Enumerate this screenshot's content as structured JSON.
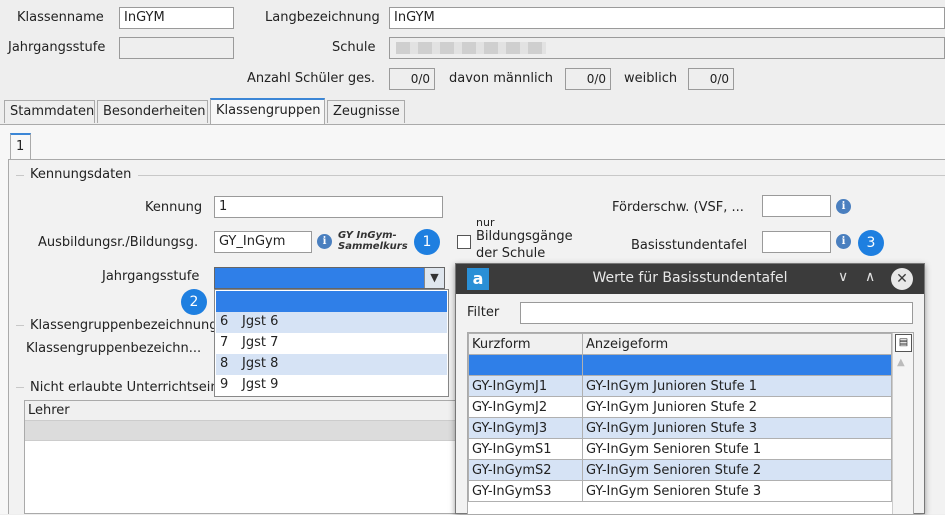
{
  "header": {
    "klassenname_label": "Klassenname",
    "klassenname_value": "InGYM",
    "langbezeichnung_label": "Langbezeichnung",
    "langbezeichnung_value": "InGYM",
    "jahrgangsstufe_label": "Jahrgangsstufe",
    "jahrgangsstufe_value": "",
    "schule_label": "Schule",
    "anzahl_label": "Anzahl Schüler ges.",
    "anzahl_value": "0/0",
    "maennlich_label": "davon männlich",
    "maennlich_value": "0/0",
    "weiblich_label": "weiblich",
    "weiblich_value": "0/0"
  },
  "tabs": [
    "Stammdaten",
    "Besonderheiten",
    "Klassengruppen",
    "Zeugnisse"
  ],
  "subtab": "1",
  "kennungsdaten": {
    "section_title": "Kennungsdaten",
    "kennung_label": "Kennung",
    "kennung_value": "1",
    "ausbildung_label": "Ausbildungsr./Bildungsg.",
    "ausbildung_value": "GY_InGym",
    "ausbildung_hint_line1": "GY InGym-",
    "ausbildung_hint_line2": "Sammelkurs",
    "nur_checkbox_line1": "nur",
    "nur_checkbox_line2": "Bildungsgänge",
    "nur_checkbox_line3": "der Schule",
    "jahrgangsstufe_label": "Jahrgangsstufe",
    "jahrgangsstufe_value": "",
    "foerderschw_label": "Förderschw. (VSF, ...",
    "foerderschw_value": "",
    "basisstundentafel_label": "Basisstundentafel",
    "basisstundentafel_value": ""
  },
  "jahrgang_dropdown": {
    "options": [
      {
        "num": "",
        "label": ""
      },
      {
        "num": "6",
        "label": "Jgst 6"
      },
      {
        "num": "7",
        "label": "Jgst 7"
      },
      {
        "num": "8",
        "label": "Jgst 8"
      },
      {
        "num": "9",
        "label": "Jgst 9"
      }
    ]
  },
  "klassengruppen": {
    "section_title": "Klassengruppenbezeichnung",
    "field_label": "Klassengruppenbezeichn..."
  },
  "nicht_erlaubt": {
    "section_title": "Nicht erlaubte Unterrichtsein",
    "column_lehrer": "Lehrer"
  },
  "badges": [
    "1",
    "2",
    "3"
  ],
  "dialog": {
    "title": "Werte für Basisstundentafel",
    "logo": "a",
    "filter_label": "Filter",
    "filter_value": "",
    "columns": [
      "Kurzform",
      "Anzeigeform"
    ],
    "rows": [
      {
        "kurz": "",
        "anzeige": ""
      },
      {
        "kurz": "GY-InGymJ1",
        "anzeige": "GY-InGym Junioren Stufe 1"
      },
      {
        "kurz": "GY-InGymJ2",
        "anzeige": "GY-InGym Junioren Stufe 2"
      },
      {
        "kurz": "GY-InGymJ3",
        "anzeige": "GY-InGym Junioren Stufe 3"
      },
      {
        "kurz": "GY-InGymS1",
        "anzeige": "GY-InGym Senioren Stufe 1"
      },
      {
        "kurz": "GY-InGymS2",
        "anzeige": "GY-InGym Senioren Stufe 2"
      },
      {
        "kurz": "GY-InGymS3",
        "anzeige": "GY-InGym Senioren Stufe 3"
      }
    ]
  },
  "colors": {
    "accent": "#1e7fe0",
    "row_alt": "#d6e3f5",
    "dialog_header": "#3b3b3b"
  }
}
